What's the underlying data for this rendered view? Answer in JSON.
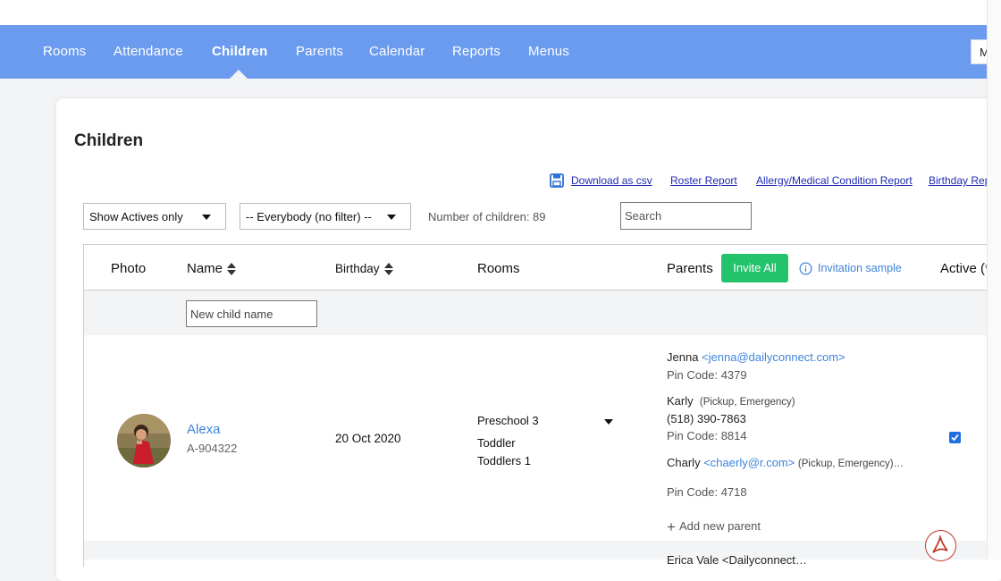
{
  "nav": {
    "items": [
      {
        "label": "Rooms"
      },
      {
        "label": "Attendance"
      },
      {
        "label": "Children",
        "active": true
      },
      {
        "label": "Parents"
      },
      {
        "label": "Calendar"
      },
      {
        "label": "Reports"
      },
      {
        "label": "Menus"
      }
    ],
    "menu_button_label": "M"
  },
  "page": {
    "title": "Children"
  },
  "links": {
    "download_csv": "Download as csv",
    "roster_report": "Roster Report",
    "allergy_report": "Allergy/Medical Condition Report",
    "birthday_report": "Birthday Rep"
  },
  "filters": {
    "status_select": "Show Actives only",
    "group_select": "-- Everybody (no filter) --",
    "count_text": "Number of children: 89",
    "search_placeholder": "Search"
  },
  "table": {
    "headers": {
      "photo": "Photo",
      "name": "Name",
      "birthday": "Birthday",
      "rooms": "Rooms",
      "parents": "Parents",
      "active": "Active (*"
    },
    "invite_all_label": "Invite All",
    "invitation_sample_label": "Invitation sample",
    "new_child_placeholder": "New child name",
    "rows": [
      {
        "name": "Alexa",
        "id": "A-904322",
        "birthday": "20 Oct 2020",
        "rooms": [
          "Preschool 3",
          "Toddler",
          "Toddlers 1"
        ],
        "active": true,
        "parents": {
          "p1_name": "Jenna",
          "p1_email": "<jenna@dailyconnect.com>",
          "p1_pin": "Pin Code: 4379",
          "p2_name": "Karly",
          "p2_note": "(Pickup, Emergency)",
          "p2_phone": "(518) 390-7863",
          "p2_pin": "Pin Code: 8814",
          "p3_name": "Charly",
          "p3_email": "<chaerly@r.com>",
          "p3_note": "(Pickup, Emergency)…",
          "p3_pin": "Pin Code: 4718"
        },
        "add_parent_label": "Add new parent"
      }
    ],
    "next_row_partial": "Erica Vale   <Dailyconnect…"
  },
  "colors": {
    "nav_bg": "#6b9bef",
    "invite_green": "#22c36b",
    "link_blue": "#3f84d9",
    "checkbox_blue": "#1f6fe0"
  },
  "icons": {
    "download": "save-disk-icon",
    "info": "info-circle-icon",
    "pdf": "adobe-pdf-icon",
    "plus": "plus-icon",
    "sort": "sort-icon",
    "dropdown": "caret-down-icon"
  }
}
